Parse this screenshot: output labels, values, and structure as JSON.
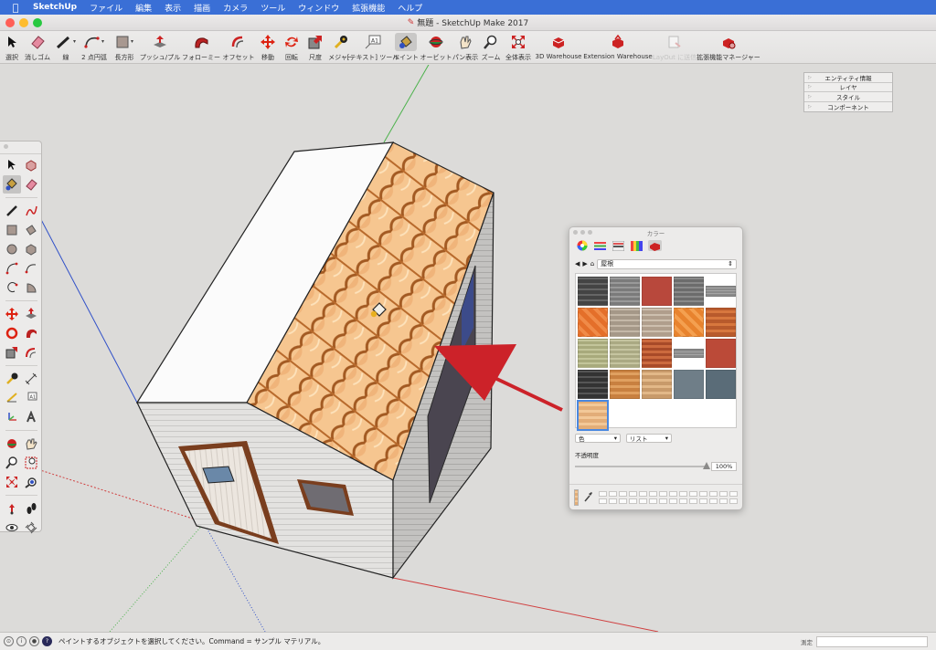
{
  "menubar": {
    "apple": "",
    "app_name": "SketchUp",
    "items": [
      "ファイル",
      "編集",
      "表示",
      "描画",
      "カメラ",
      "ツール",
      "ウィンドウ",
      "拡張機能",
      "ヘルプ"
    ]
  },
  "window": {
    "title": "無題 - SketchUp Make 2017"
  },
  "toolbar": {
    "items": [
      {
        "label": "選択",
        "icon": "select-arrow-icon"
      },
      {
        "label": "消しゴム",
        "icon": "eraser-icon"
      },
      {
        "label": "線",
        "icon": "pencil-line-icon"
      },
      {
        "label": "2 点円弧",
        "icon": "arc-icon"
      },
      {
        "label": "長方形",
        "icon": "rectangle-icon"
      },
      {
        "label": "プッシュ/プル",
        "icon": "push-pull-icon"
      },
      {
        "label": "フォローミー",
        "icon": "follow-me-icon"
      },
      {
        "label": "オフセット",
        "icon": "offset-icon"
      },
      {
        "label": "移動",
        "icon": "move-icon"
      },
      {
        "label": "回転",
        "icon": "rotate-icon"
      },
      {
        "label": "尺度",
        "icon": "scale-icon"
      },
      {
        "label": "メジャー",
        "icon": "tape-measure-icon"
      },
      {
        "label": "[テキスト] ツール",
        "icon": "text-tool-icon"
      },
      {
        "label": "ペイント",
        "icon": "paint-bucket-icon"
      },
      {
        "label": "オービット",
        "icon": "orbit-icon"
      },
      {
        "label": "パン表示",
        "icon": "pan-icon"
      },
      {
        "label": "ズーム",
        "icon": "zoom-icon"
      },
      {
        "label": "全体表示",
        "icon": "zoom-extents-icon"
      },
      {
        "label": "3D Warehouse",
        "icon": "3d-warehouse-icon"
      },
      {
        "label": "Extension Warehouse",
        "icon": "extension-warehouse-icon"
      },
      {
        "label": "LayOut に送信",
        "icon": "send-to-layout-icon"
      },
      {
        "label": "拡張機能マネージャー",
        "icon": "extension-manager-icon"
      }
    ]
  },
  "tray": {
    "panels": [
      "エンティティ情報",
      "レイヤ",
      "スタイル",
      "コンポーネント"
    ]
  },
  "colors_panel": {
    "title": "カラー",
    "library": "屋根",
    "color_select": "色",
    "view_select": "リスト",
    "opacity_label": "不透明度",
    "opacity_value": "100%",
    "opacity": 1.0
  },
  "statusbar": {
    "message": "ペイントするオブジェクトを選択してください。Command = サンプル マテリアル。",
    "measure_label": "測定"
  },
  "colors": {
    "menubar_bg": "#3a6fd6",
    "roof_tile": "#e8a868",
    "accent_red": "#cc2229",
    "axis_green": "#4cb24c",
    "axis_blue": "#3050c8",
    "axis_red": "#d04040"
  }
}
